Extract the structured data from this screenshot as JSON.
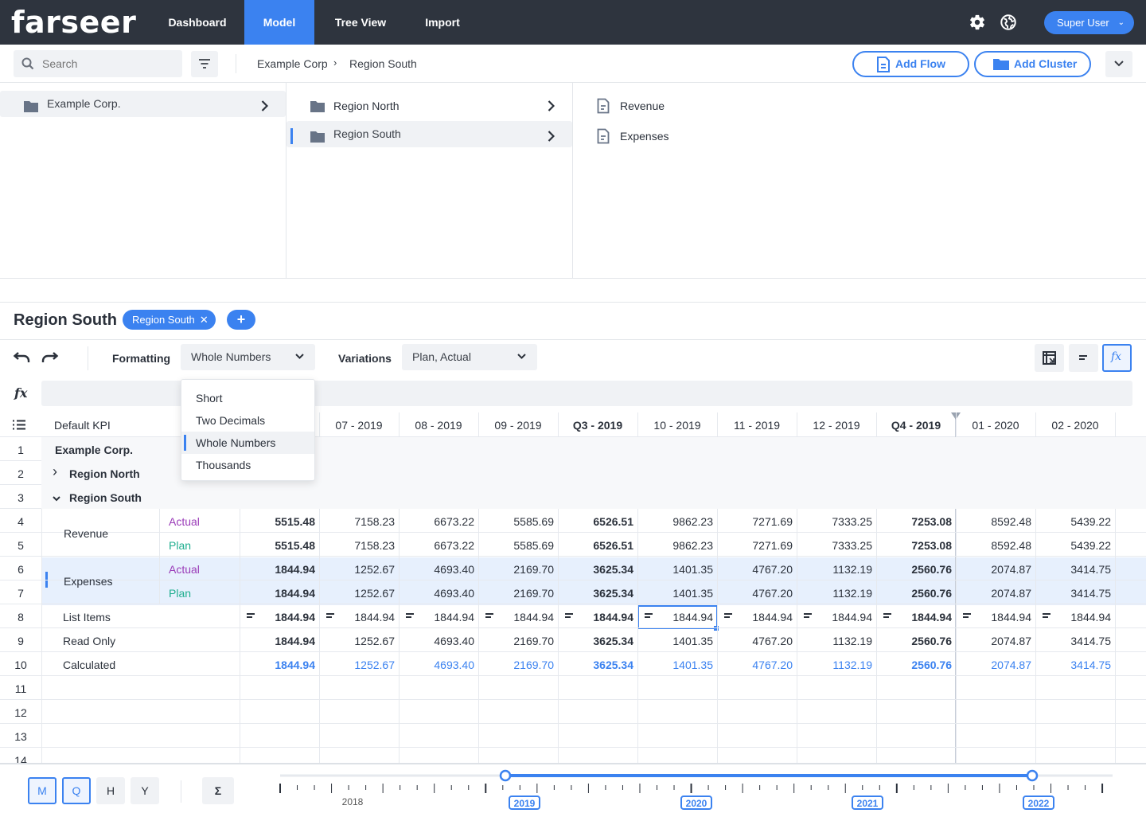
{
  "app": {
    "logo": "farseer"
  },
  "nav": {
    "tabs": [
      {
        "label": "Dashboard"
      },
      {
        "label": "Model"
      },
      {
        "label": "Tree View"
      },
      {
        "label": "Import"
      }
    ],
    "user": "Super User"
  },
  "toolbar2": {
    "search_placeholder": "Search",
    "breadcrumb": [
      "Example Corp",
      "Region South"
    ],
    "add_flow": "Add Flow",
    "add_cluster": "Add Cluster"
  },
  "tree": {
    "col1": [
      {
        "label": "Example Corp."
      }
    ],
    "col2": [
      {
        "label": "Region North"
      },
      {
        "label": "Region South"
      }
    ],
    "col3": [
      {
        "label": "Revenue"
      },
      {
        "label": "Expenses"
      }
    ]
  },
  "section": {
    "title": "Region South",
    "chip": "Region South",
    "chip_close": "✕",
    "add": "+"
  },
  "toolbar": {
    "formatting_label": "Formatting",
    "formatting_value": "Whole Numbers",
    "variations_label": "Variations",
    "variations_value": "Plan, Actual",
    "fx": "fx"
  },
  "dropdown": {
    "options": [
      "Short",
      "Two Decimals",
      "Whole Numbers",
      "Thousands"
    ],
    "selected": "Whole Numbers"
  },
  "grid": {
    "kpi_header": "Default KPI",
    "columns": [
      "07 - 2019",
      "08 - 2019",
      "09 - 2019",
      "Q3 - 2019",
      "10 - 2019",
      "11 - 2019",
      "12 - 2019",
      "Q4 - 2019",
      "01 - 2020",
      "02 - 2020"
    ],
    "row_numbers": [
      "1",
      "2",
      "3",
      "4",
      "5",
      "6",
      "7",
      "8",
      "9",
      "10",
      "11",
      "12",
      "13",
      "14"
    ],
    "labels": {
      "r1": "Example Corp.",
      "r2": "Region North",
      "r3": "Region South",
      "revenue": "Revenue",
      "expenses": "Expenses",
      "actual": "Actual",
      "plan": "Plan",
      "list": "List Items",
      "readonly": "Read Only",
      "calc": "Calculated"
    },
    "revenue": [
      "5515.48",
      "7158.23",
      "6673.22",
      "5585.69",
      "6526.51",
      "9862.23",
      "7271.69",
      "7333.25",
      "7253.08",
      "8592.48",
      "5439.22"
    ],
    "expenses": [
      "1844.94",
      "1252.67",
      "4693.40",
      "2169.70",
      "3625.34",
      "1401.35",
      "4767.20",
      "1132.19",
      "2560.76",
      "2074.87",
      "3414.75"
    ],
    "list_items": [
      "1844.94",
      "1844.94",
      "1844.94",
      "1844.94",
      "1844.94",
      "1844.94",
      "1844.94",
      "1844.94",
      "1844.94",
      "1844.94",
      "1844.94"
    ],
    "bold_cols": [
      0,
      4,
      8
    ]
  },
  "bottom": {
    "periods": [
      "M",
      "Q",
      "H",
      "Y"
    ],
    "sum": "Σ",
    "years": [
      "2018",
      "2019",
      "2020",
      "2021",
      "2022"
    ]
  },
  "colors": {
    "accent": "#3b82f0",
    "topbar": "#2e343e",
    "actual": "#9a3bb8",
    "plan": "#1fae8f"
  }
}
